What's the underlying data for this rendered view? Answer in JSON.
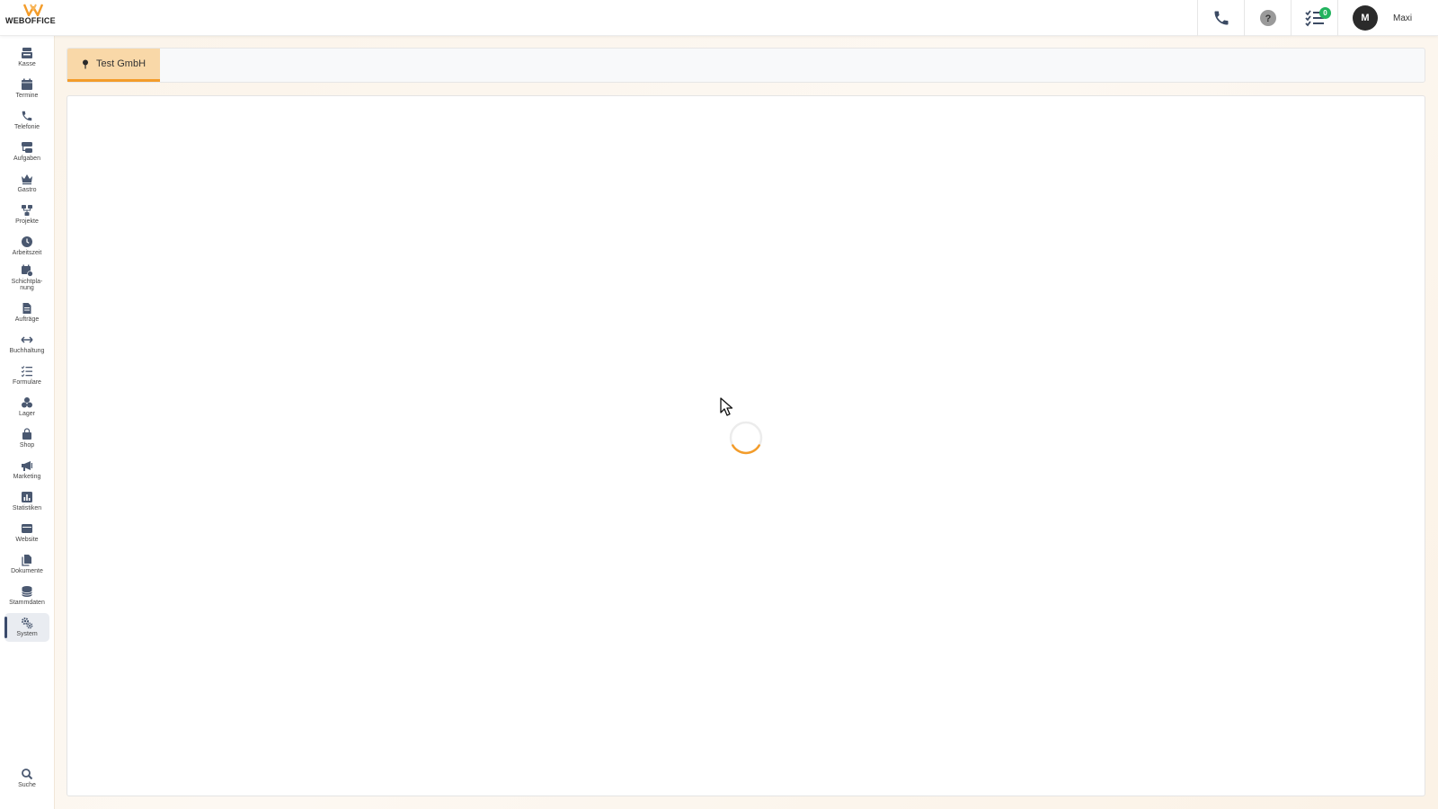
{
  "header": {
    "logo_text": "WEBOFFICE",
    "phone_icon": "phone-icon",
    "help_icon": "help-icon",
    "tasks_icon": "checklist-icon",
    "tasks_badge": "0",
    "user_initial": "M",
    "user_name": "Maxi"
  },
  "colors": {
    "accent": "#f39c2a",
    "tab_bg": "#f9d8a8",
    "badge": "#22b35e",
    "avatar": "#2b2b2b"
  },
  "sidebar": {
    "items": [
      {
        "label": "Kasse",
        "icon": "cash-register-icon"
      },
      {
        "label": "Termine",
        "icon": "calendar-icon"
      },
      {
        "label": "Telefonie",
        "icon": "phone-icon"
      },
      {
        "label": "Aufgaben",
        "icon": "tasks-icon"
      },
      {
        "label": "Gastro",
        "icon": "crown-icon"
      },
      {
        "label": "Projekte",
        "icon": "project-tree-icon"
      },
      {
        "label": "Arbeitszeit",
        "icon": "clock-icon"
      },
      {
        "label": "Schichtpla-\nnung",
        "icon": "shift-calendar-icon"
      },
      {
        "label": "Aufträge",
        "icon": "document-icon"
      },
      {
        "label": "Buchhaltung",
        "icon": "arrows-left-right-icon"
      },
      {
        "label": "Formulare",
        "icon": "form-list-icon"
      },
      {
        "label": "Lager",
        "icon": "boxes-icon"
      },
      {
        "label": "Shop",
        "icon": "shopping-bag-icon"
      },
      {
        "label": "Marketing",
        "icon": "megaphone-icon"
      },
      {
        "label": "Statistiken",
        "icon": "bar-chart-icon"
      },
      {
        "label": "Website",
        "icon": "browser-window-icon"
      },
      {
        "label": "Dokumente",
        "icon": "files-icon"
      },
      {
        "label": "Stammdaten",
        "icon": "database-icon"
      },
      {
        "label": "System",
        "icon": "gears-icon",
        "active": true
      }
    ],
    "search_label": "Suche"
  },
  "main": {
    "tabs": [
      {
        "label": "Test GmbH",
        "icon": "location-pin-icon",
        "active": true
      }
    ],
    "loading": true
  }
}
